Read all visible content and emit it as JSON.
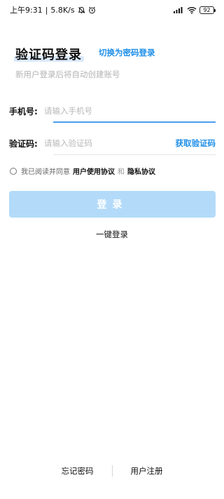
{
  "status_bar": {
    "time": "上午9:31",
    "separator": "|",
    "net_speed": "5.8K/s",
    "icons": [
      "mute-icon",
      "alarm-icon",
      "signal-icon",
      "wifi-icon",
      "battery-icon"
    ],
    "battery": "92"
  },
  "header": {
    "title": "验证码登录",
    "switch_link": "切换为密码登录",
    "subtitle": "新用户登录后将自动创建账号"
  },
  "form": {
    "phone_label": "手机号:",
    "phone_placeholder": "请输入手机号",
    "phone_value": "",
    "code_label": "验证码:",
    "code_placeholder": "请输入验证码",
    "code_value": "",
    "get_code": "获取验证码"
  },
  "agreement": {
    "prefix": "我已阅读并同意",
    "terms": "用户使用协议",
    "and": "和",
    "privacy": "隐私协议",
    "checked": false
  },
  "actions": {
    "login": "登录",
    "one_key_login": "一键登录"
  },
  "footer": {
    "forgot_password": "忘记密码",
    "register": "用户注册"
  },
  "colors": {
    "accent": "#1f8fe8",
    "login_button_disabled": "#b3dbf9",
    "title_highlight": "#dbe9fb"
  }
}
